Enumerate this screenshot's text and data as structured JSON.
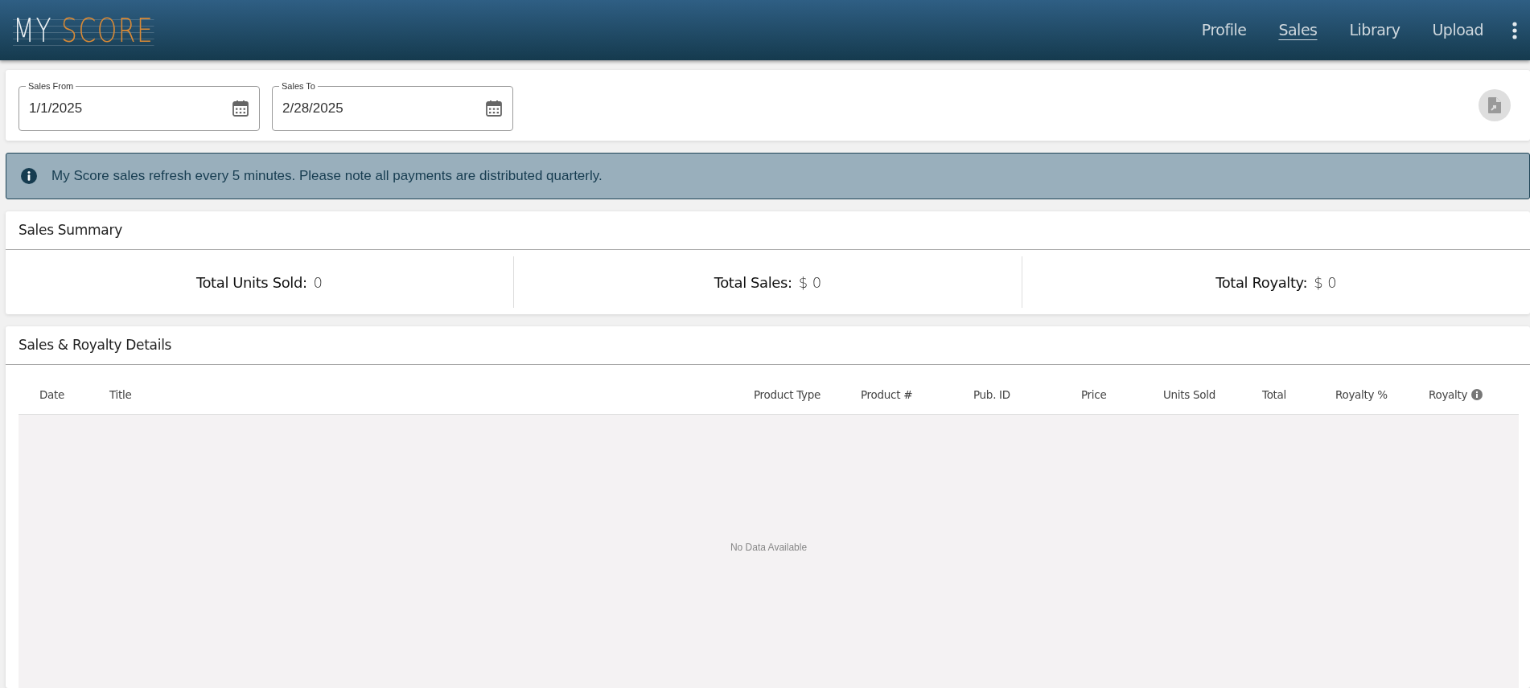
{
  "logo": {
    "first": "MY",
    "second": "SCORE"
  },
  "nav": [
    {
      "label": "Profile",
      "selected": false
    },
    {
      "label": "Sales",
      "selected": true
    },
    {
      "label": "Library",
      "selected": false
    },
    {
      "label": "Upload",
      "selected": false
    }
  ],
  "filters": [
    {
      "label": "Sales From",
      "value": "1/1/2025"
    },
    {
      "label": "Sales To",
      "value": "2/28/2025"
    }
  ],
  "export_button": {
    "disabled": true
  },
  "alert": {
    "text": "My Score sales refresh every 5 minutes. Please note all payments are distributed quarterly."
  },
  "summary": {
    "title": "Sales Summary",
    "items": [
      {
        "label": "Total Units Sold:",
        "value": "0"
      },
      {
        "label": "Total Sales:",
        "value": "$ 0"
      },
      {
        "label": "Total Royalty:",
        "value": "$ 0"
      }
    ]
  },
  "details": {
    "title": "Sales & Royalty Details",
    "columns": [
      {
        "label": "Date",
        "info": false
      },
      {
        "label": "Title",
        "info": false
      },
      {
        "label": "Product Type",
        "info": false
      },
      {
        "label": "Product #",
        "info": false
      },
      {
        "label": "Pub. ID",
        "info": false
      },
      {
        "label": "Price",
        "info": false
      },
      {
        "label": "Units Sold",
        "info": false
      },
      {
        "label": "Total",
        "info": false
      },
      {
        "label": "Royalty %",
        "info": false
      },
      {
        "label": "Royalty",
        "info": true
      }
    ],
    "empty_text": "No Data Available"
  }
}
